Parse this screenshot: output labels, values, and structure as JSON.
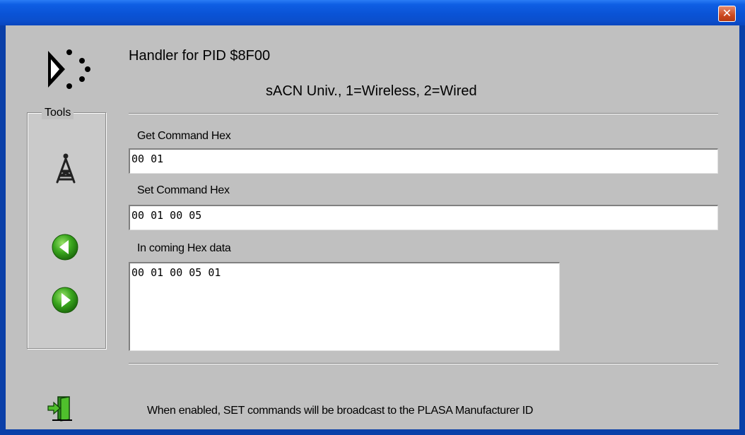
{
  "window": {
    "close_glyph": "✕",
    "accent": "#0a53d6",
    "client_bg": "#c0c0c0"
  },
  "header": {
    "title": "Handler for PID $8F00",
    "subtitle": "sACN Univ., 1=Wireless, 2=Wired",
    "logo_icon": "pid-logo-icon"
  },
  "tools": {
    "legend": "Tools",
    "items": [
      {
        "icon": "antenna-tower-icon"
      },
      {
        "icon": "back-arrow-icon"
      },
      {
        "icon": "forward-arrow-icon"
      }
    ]
  },
  "fields": {
    "get_label": "Get Command Hex",
    "get_value": "00 01",
    "set_label": "Set Command Hex",
    "set_value": "00 01 00 05",
    "incoming_label": "In coming Hex data",
    "incoming_value": "00 01 00 05 01"
  },
  "footer": {
    "exit_icon": "exit-door-icon",
    "message": "When enabled, SET commands will be broadcast to the  PLASA Manufacturer ID"
  }
}
